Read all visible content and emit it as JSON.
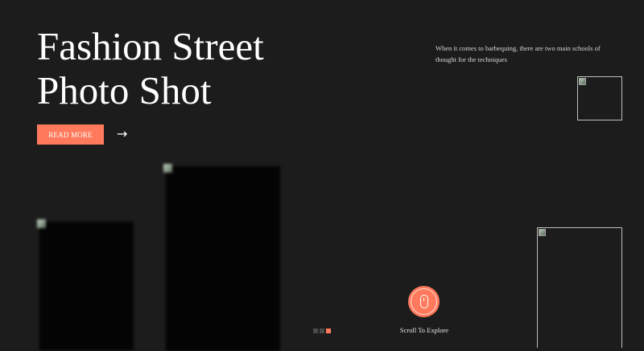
{
  "hero": {
    "title_line_1": "Fashion Street",
    "title_line_2": "Photo Shot",
    "read_more_label": "READ MORE",
    "arrow_icon": "arrow-right-icon"
  },
  "intro": {
    "text": "When it comes to barbequing, there are two main schools of thought for the techniques"
  },
  "slider": {
    "dot_count": 3,
    "active_index": 2
  },
  "scroll": {
    "label": "Scroll To Explore",
    "icon": "mouse-icon"
  },
  "colors": {
    "background": "#1c1c1c",
    "accent": "#ff7a5c",
    "text": "#ffffff",
    "muted_text": "#d6d6d6",
    "dot_inactive": "#4a4a4a"
  }
}
